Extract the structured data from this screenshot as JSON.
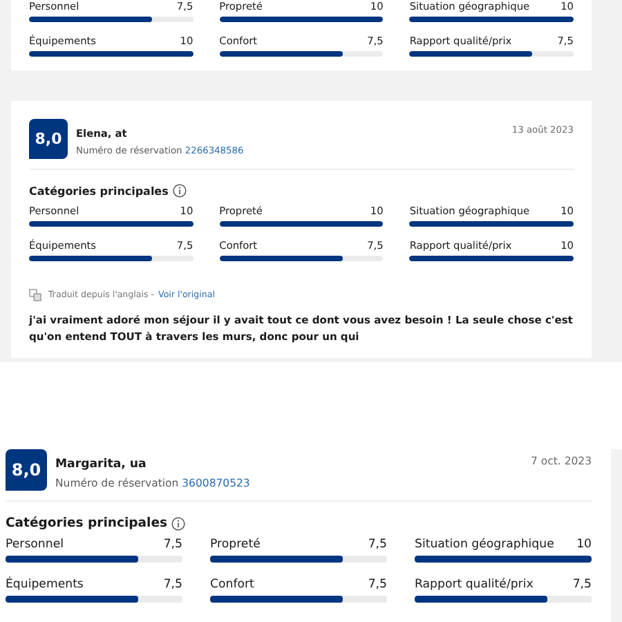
{
  "sections": [
    {
      "kind": "grey",
      "reviews": [
        {
          "categories": [
            {
              "name": "Personnel",
              "score": "7,5",
              "level": 0.75
            },
            {
              "name": "Propreté",
              "score": "10",
              "level": 1
            },
            {
              "name": "Situation géographique",
              "score": "10",
              "level": 1
            },
            {
              "name": "Équipements",
              "score": "10",
              "level": 1
            },
            {
              "name": "Confort",
              "score": "7,5",
              "level": 0.75
            },
            {
              "name": "Rapport qualité/prix",
              "score": "7,5",
              "level": 0.75
            }
          ]
        },
        {
          "score": "8,0",
          "name": "Elena, at",
          "booking_label": "Numéro de réservation",
          "booking_number": "2266348586",
          "date": "13 août 2023",
          "categories_title": "Catégories principales",
          "categories": [
            {
              "name": "Personnel",
              "score": "10",
              "level": 1
            },
            {
              "name": "Propreté",
              "score": "10",
              "level": 1
            },
            {
              "name": "Situation géographique",
              "score": "10",
              "level": 1
            },
            {
              "name": "Équipements",
              "score": "7,5",
              "level": 0.75
            },
            {
              "name": "Confort",
              "score": "7,5",
              "level": 0.75
            },
            {
              "name": "Rapport qualité/prix",
              "score": "10",
              "level": 1
            }
          ],
          "translation": "Traduit depuis l'anglais -",
          "original_link": "Voir l'original",
          "text": "j'ai vraiment adoré mon séjour il y avait tout ce dont vous avez besoin ! La seule chose c'est qu'on entend TOUT à travers les murs, donc pour un qui"
        }
      ]
    },
    {
      "kind": "white",
      "reviews": [
        {
          "score": "8,0",
          "name": "Margarita, ua",
          "booking_label": "Numéro de réservation",
          "booking_number": "3600870523",
          "date": "7 oct. 2023",
          "categories_title": "Catégories principales",
          "categories": [
            {
              "name": "Personnel",
              "score": "7,5",
              "level": 0.75
            },
            {
              "name": "Propreté",
              "score": "7,5",
              "level": 0.75
            },
            {
              "name": "Situation géographique",
              "score": "10",
              "level": 1
            },
            {
              "name": "Équipements",
              "score": "7,5",
              "level": 0.75
            },
            {
              "name": "Confort",
              "score": "7,5",
              "level": 0.75
            },
            {
              "name": "Rapport qualité/prix",
              "score": "7,5",
              "level": 0.75
            }
          ]
        }
      ]
    }
  ]
}
